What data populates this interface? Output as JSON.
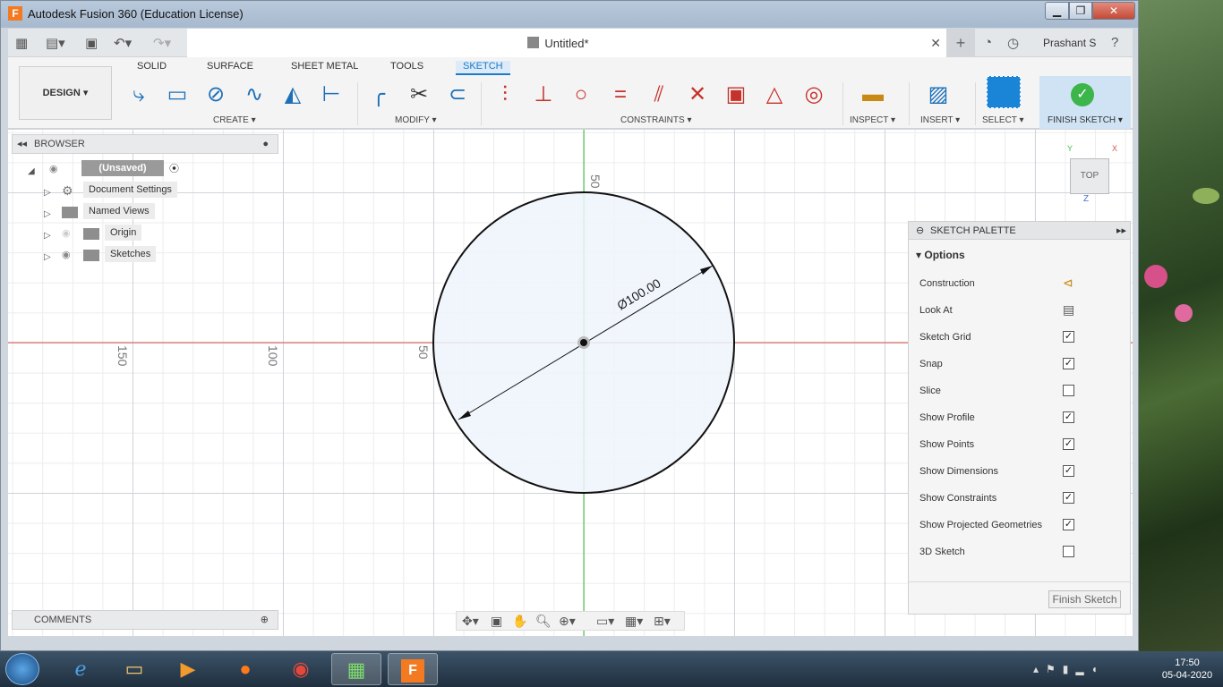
{
  "window": {
    "title": "Autodesk Fusion 360 (Education License)"
  },
  "document": {
    "title": "Untitled*",
    "user": "Prashant S"
  },
  "ribbon": {
    "workspace": "DESIGN ▾",
    "tabs": [
      "SOLID",
      "SURFACE",
      "SHEET METAL",
      "TOOLS",
      "SKETCH"
    ],
    "groups": [
      "CREATE ▾",
      "MODIFY ▾",
      "CONSTRAINTS ▾",
      "INSPECT ▾",
      "INSERT ▾",
      "SELECT ▾"
    ],
    "finish": "FINISH SKETCH ▾"
  },
  "browser": {
    "title": "BROWSER",
    "root": "(Unsaved)",
    "items": [
      "Document Settings",
      "Named Views",
      "Origin",
      "Sketches"
    ]
  },
  "comments": {
    "title": "COMMENTS"
  },
  "viewcube": {
    "face": "TOP",
    "x": "X",
    "y": "Y",
    "z": "Z"
  },
  "canvas": {
    "dimension": "Ø100.00",
    "ruler_top": "50",
    "ruler_left": [
      "150",
      "100",
      "50"
    ]
  },
  "palette": {
    "title": "SKETCH PALETTE",
    "section": "Options",
    "options": [
      {
        "label": "Construction",
        "type": "icon",
        "checked": ""
      },
      {
        "label": "Look At",
        "type": "icon",
        "checked": ""
      },
      {
        "label": "Sketch Grid",
        "type": "checkbox",
        "checked": "✓"
      },
      {
        "label": "Snap",
        "type": "checkbox",
        "checked": "✓"
      },
      {
        "label": "Slice",
        "type": "checkbox",
        "checked": ""
      },
      {
        "label": "Show Profile",
        "type": "checkbox",
        "checked": "✓"
      },
      {
        "label": "Show Points",
        "type": "checkbox",
        "checked": "✓"
      },
      {
        "label": "Show Dimensions",
        "type": "checkbox",
        "checked": "✓"
      },
      {
        "label": "Show Constraints",
        "type": "checkbox",
        "checked": "✓"
      },
      {
        "label": "Show Projected Geometries",
        "type": "checkbox",
        "checked": "✓"
      },
      {
        "label": "3D Sketch",
        "type": "checkbox",
        "checked": ""
      }
    ],
    "finish_button": "Finish Sketch"
  },
  "taskbar": {
    "time": "17:50",
    "date": "05-04-2020",
    "app_badge": "F"
  },
  "colors": {
    "accent": "#1b7ac9",
    "finish_green": "#3cb54a",
    "x_axis": "#d9534f",
    "y_axis": "#3fc13f"
  }
}
